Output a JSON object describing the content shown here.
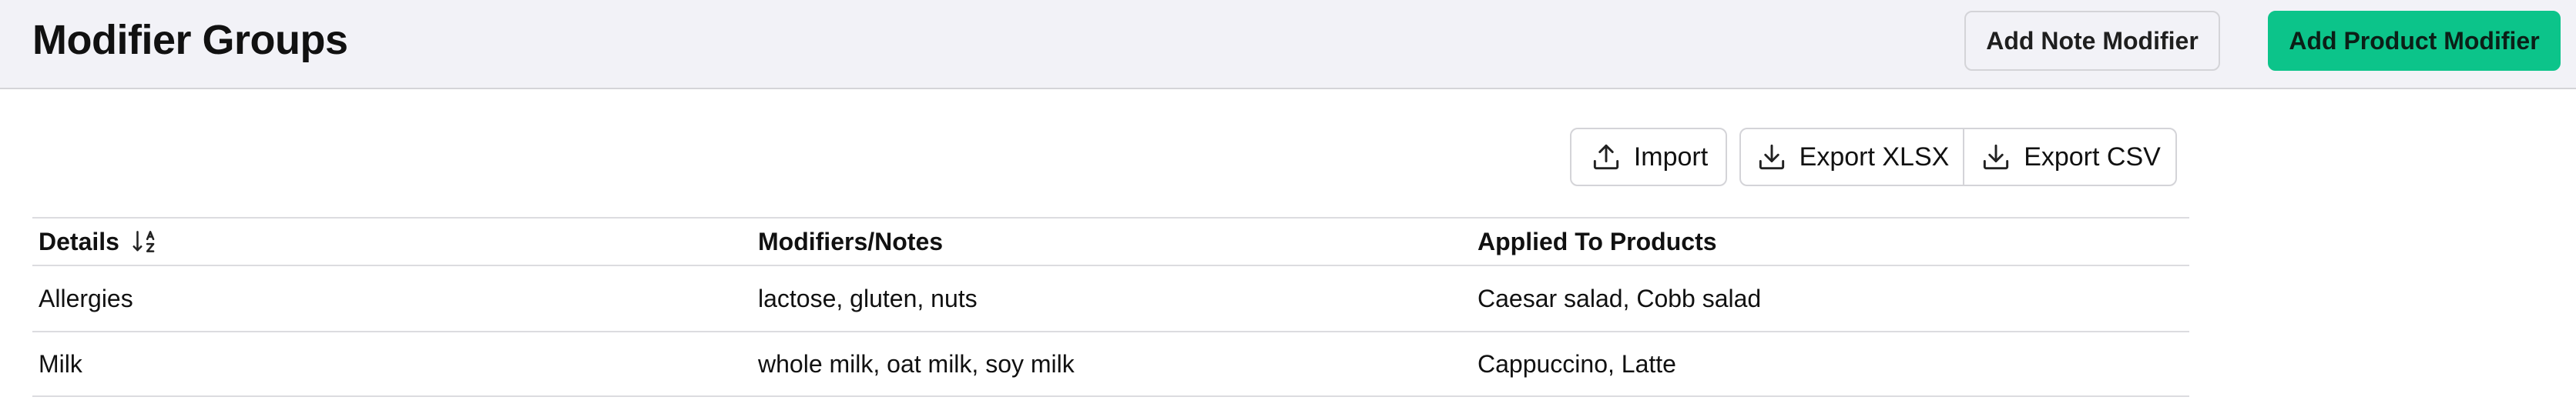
{
  "header": {
    "title": "Modifier Groups",
    "add_note_label": "Add Note Modifier",
    "add_product_label": "Add Product Modifier",
    "accent_color": "#0cc48a"
  },
  "toolbar": {
    "import_label": "Import",
    "import_icon": "upload-icon",
    "export_xlsx_label": "Export XLSX",
    "export_csv_label": "Export CSV",
    "export_icon": "download-icon"
  },
  "table": {
    "columns": [
      "Details",
      "Modifiers/Notes",
      "Applied To Products"
    ],
    "sort_icon": "sort-alpha-icon",
    "rows": [
      {
        "details": "Allergies",
        "modifiers": "lactose, gluten, nuts",
        "products": "Caesar salad, Cobb salad"
      },
      {
        "details": "Milk",
        "modifiers": "whole milk, oat milk, soy milk",
        "products": "Cappuccino, Latte"
      }
    ]
  }
}
